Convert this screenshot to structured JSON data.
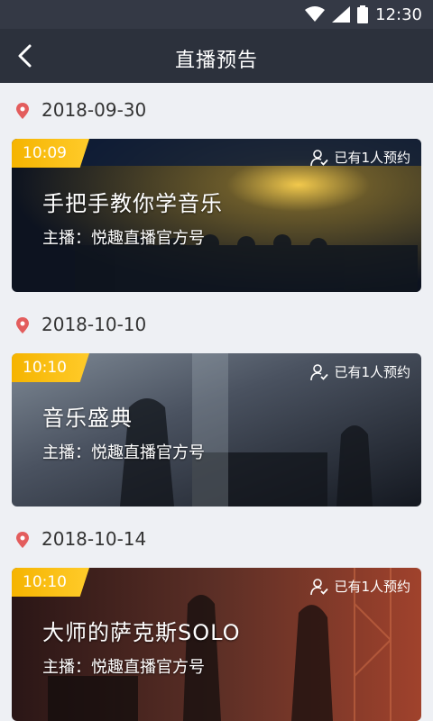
{
  "status": {
    "time": "12:30"
  },
  "nav": {
    "title": "直播预告"
  },
  "schedule": [
    {
      "date": "2018-09-30",
      "time": "10:09",
      "reserve": "已有1人预约",
      "title": "手把手教你学音乐",
      "host": "主播：悦趣直播官方号"
    },
    {
      "date": "2018-10-10",
      "time": "10:10",
      "reserve": "已有1人预约",
      "title": "音乐盛典",
      "host": "主播：悦趣直播官方号"
    },
    {
      "date": "2018-10-14",
      "time": "10:10",
      "reserve": "已有1人预约",
      "title": "大师的萨克斯SOLO",
      "host": "主播：悦趣直播官方号"
    }
  ],
  "colors": {
    "header": "#2c313c",
    "badge": "#f5b400",
    "pin": "#e35d5d",
    "background": "#eef0f4"
  }
}
